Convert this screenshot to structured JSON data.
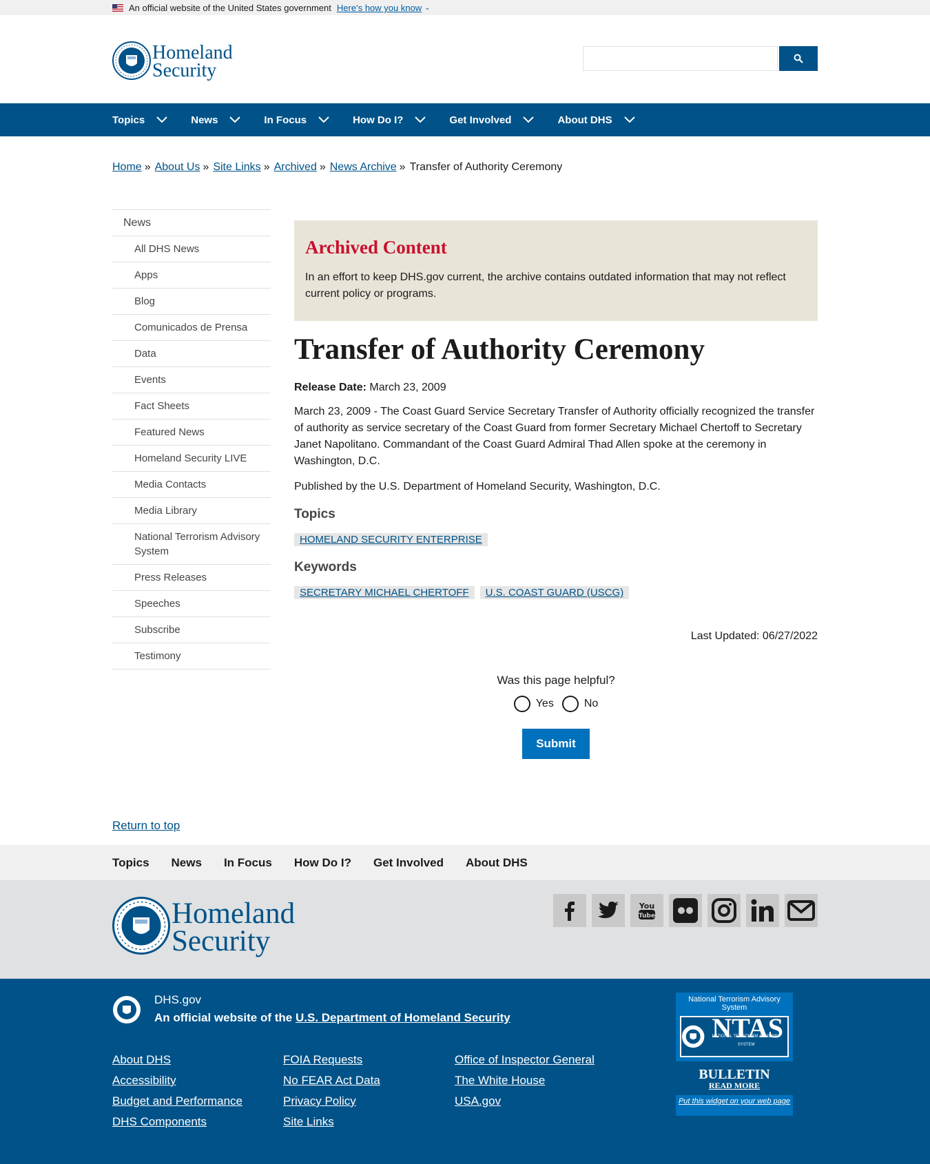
{
  "gov_banner": {
    "text": "An official website of the United States government",
    "howto": "Here’s how you know"
  },
  "header": {
    "logo_line1": "Homeland",
    "logo_line2": "Security",
    "search_placeholder": ""
  },
  "main_nav": {
    "items": [
      "Topics",
      "News",
      "In Focus",
      "How Do I?",
      "Get Involved",
      "About DHS"
    ]
  },
  "breadcrumb": {
    "items": [
      "Home",
      "About Us",
      "Site Links",
      "Archived",
      "News Archive"
    ],
    "current": "Transfer of Authority Ceremony"
  },
  "sidebar": {
    "top": "News",
    "items": [
      "All DHS News",
      "Apps",
      "Blog",
      "Comunicados de Prensa",
      "Data",
      "Events",
      "Fact Sheets",
      "Featured News",
      "Homeland Security LIVE",
      "Media Contacts",
      "Media Library",
      "National Terrorism Advisory System",
      "Press Releases",
      "Speeches",
      "Subscribe",
      "Testimony"
    ]
  },
  "archived": {
    "title": "Archived Content",
    "text": "In an effort to keep DHS.gov current, the archive contains outdated information that may not reflect current policy or programs."
  },
  "article": {
    "title": "Transfer of Authority Ceremony",
    "release_label": "Release Date:",
    "release_date": "March 23, 2009",
    "body": "March 23, 2009 - The Coast Guard Service Secretary Transfer of Authority officially recognized the transfer of authority as service secretary of the Coast Guard from former Secretary Michael Chertoff to Secretary Janet Napolitano. Commandant of the Coast Guard Admiral Thad Allen spoke at the ceremony in Washington, D.C.",
    "published": "Published by the U.S. Department of Homeland Security, Washington, D.C.",
    "topics_heading": "Topics",
    "topics": [
      "HOMELAND SECURITY ENTERPRISE"
    ],
    "keywords_heading": "Keywords",
    "keywords": [
      "SECRETARY MICHAEL CHERTOFF",
      "U.S. COAST GUARD (USCG)"
    ],
    "last_updated": "Last Updated: 06/27/2022"
  },
  "feedback": {
    "question": "Was this page helpful?",
    "yes": "Yes",
    "no": "No",
    "submit": "Submit"
  },
  "return_top": "Return to top",
  "footer_nav": {
    "items": [
      "Topics",
      "News",
      "In Focus",
      "How Do I?",
      "Get Involved",
      "About DHS"
    ]
  },
  "footer_logo": {
    "line1": "Homeland",
    "line2": "Security"
  },
  "social": {
    "items": [
      "facebook-icon",
      "twitter-icon",
      "youtube-icon",
      "flickr-icon",
      "instagram-icon",
      "linkedin-icon",
      "email-icon"
    ],
    "youtube_label": "You Tube",
    "linkedin_label": "in"
  },
  "footer_bottom": {
    "site": "DHS.gov",
    "official_prefix": "An official website of the",
    "official_link": "U.S. Department of Homeland Security",
    "col1": [
      "About DHS",
      "Accessibility",
      "Budget and Performance",
      "DHS Components"
    ],
    "col2": [
      "FOIA Requests",
      "No FEAR Act Data",
      "Privacy Policy",
      "Site Links"
    ],
    "col3": [
      "Office of Inspector General",
      "The White House",
      "USA.gov"
    ]
  },
  "ntas": {
    "header": "National Terrorism Advisory System",
    "letters": "NTAS",
    "small": "NATIONAL TERRORISM ADVISORY SYSTEM",
    "bulletin": "BULLETIN",
    "readmore": "READ MORE",
    "widget": "Put this widget on your web page"
  },
  "colors": {
    "brand_blue": "#005288",
    "button_blue": "#0071bc",
    "archived_red": "#c8102e",
    "archived_bg": "#e9e4d8"
  }
}
